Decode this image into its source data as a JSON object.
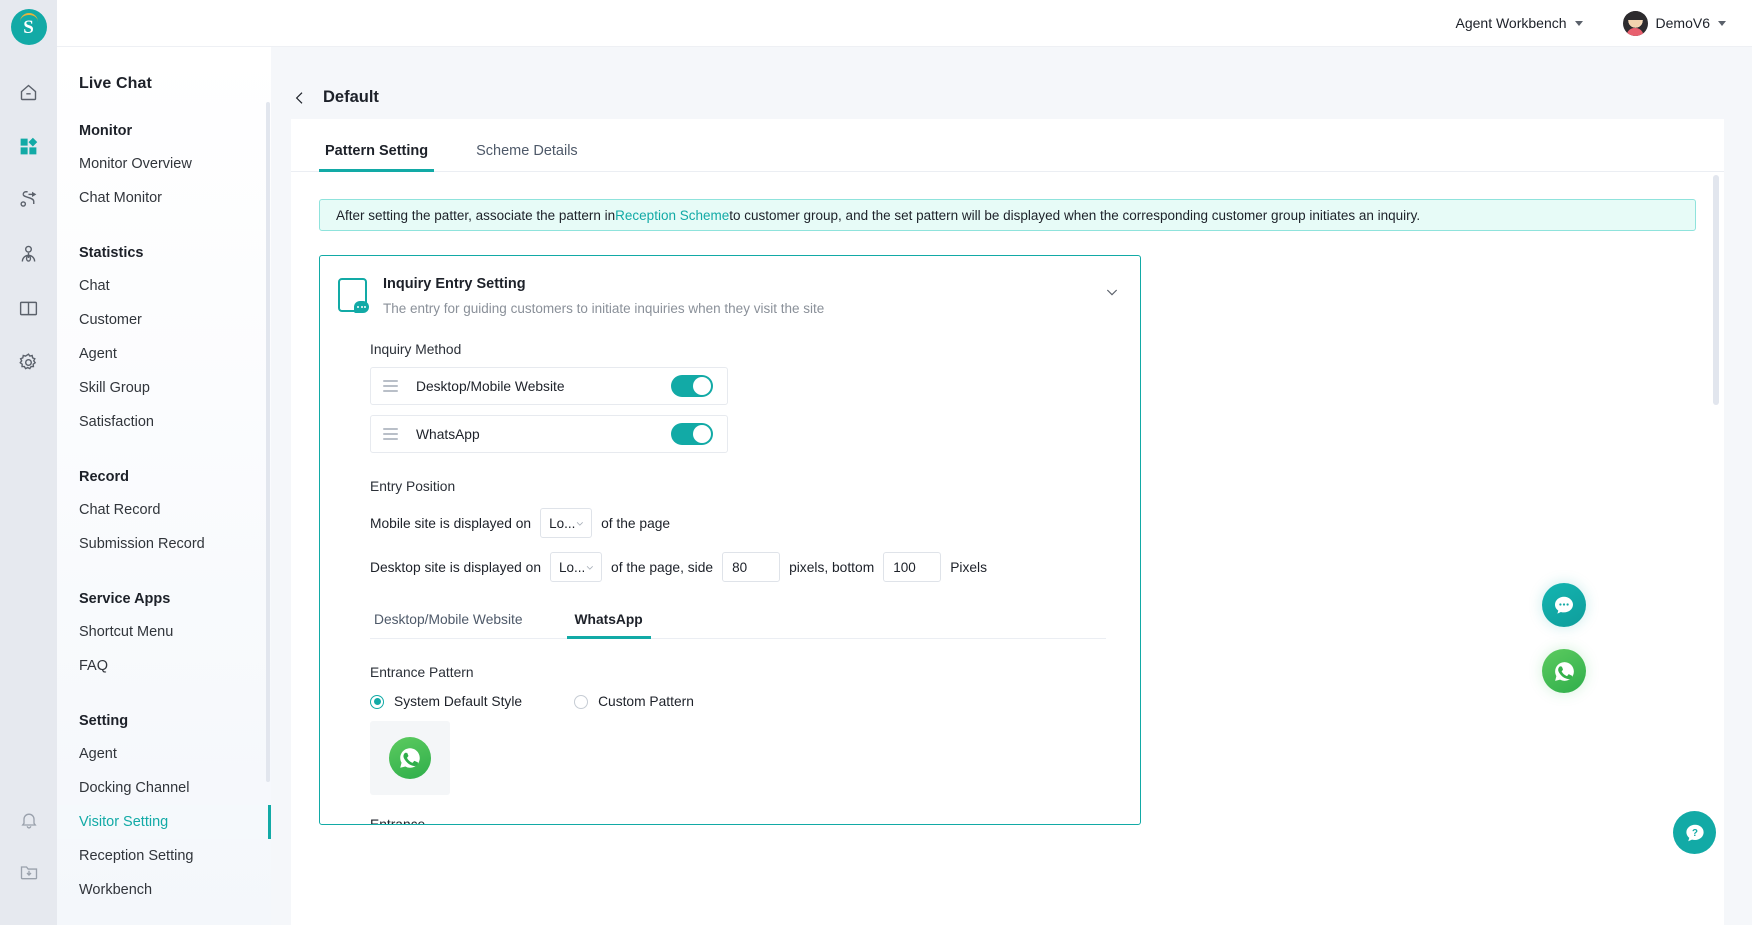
{
  "rail": {
    "logo_letter": "S",
    "icons": [
      {
        "name": "home-icon"
      },
      {
        "name": "apps-grid-icon"
      },
      {
        "name": "workflow-icon"
      },
      {
        "name": "visitor-insight-icon"
      },
      {
        "name": "knowledge-book-icon"
      },
      {
        "name": "gear-icon"
      }
    ],
    "bottom_icons": [
      {
        "name": "bell-icon"
      },
      {
        "name": "download-folder-icon"
      }
    ]
  },
  "topbar": {
    "workspace_label": "Agent Workbench",
    "user_label": "DemoV6"
  },
  "sidebar": {
    "title": "Live Chat",
    "groups": [
      {
        "label": "Monitor",
        "items": [
          {
            "label": "Monitor Overview",
            "active": false
          },
          {
            "label": "Chat Monitor",
            "active": false
          }
        ]
      },
      {
        "label": "Statistics",
        "items": [
          {
            "label": "Chat",
            "active": false
          },
          {
            "label": "Customer",
            "active": false
          },
          {
            "label": "Agent",
            "active": false
          },
          {
            "label": "Skill Group",
            "active": false
          },
          {
            "label": "Satisfaction",
            "active": false
          }
        ]
      },
      {
        "label": "Record",
        "items": [
          {
            "label": "Chat Record",
            "active": false
          },
          {
            "label": "Submission Record",
            "active": false
          }
        ]
      },
      {
        "label": "Service Apps",
        "items": [
          {
            "label": "Shortcut Menu",
            "active": false
          },
          {
            "label": "FAQ",
            "active": false
          }
        ]
      },
      {
        "label": "Setting",
        "items": [
          {
            "label": "Agent",
            "active": false
          },
          {
            "label": "Docking Channel",
            "active": false
          },
          {
            "label": "Visitor Setting",
            "active": true
          },
          {
            "label": "Reception Setting",
            "active": false
          },
          {
            "label": "Workbench",
            "active": false
          }
        ]
      }
    ]
  },
  "page": {
    "title": "Default",
    "back_icon": "chevron-left-icon"
  },
  "tabs": [
    {
      "label": "Pattern Setting",
      "active": true
    },
    {
      "label": "Scheme Details",
      "active": false
    }
  ],
  "banner": {
    "text_before": "After setting the patter, associate the pattern in ",
    "link": "Reception Scheme",
    "text_after": " to customer group, and the set pattern will be displayed when the corresponding customer group initiates an inquiry."
  },
  "card": {
    "title": "Inquiry Entry Setting",
    "subtitle": "The entry for guiding customers to initiate inquiries when they visit the site",
    "collapse_icon": "chevron-down-icon",
    "inquiry_method": {
      "label": "Inquiry Method",
      "rows": [
        {
          "name": "Desktop/Mobile Website",
          "enabled": true
        },
        {
          "name": "WhatsApp",
          "enabled": true
        }
      ]
    },
    "entry_position": {
      "label": "Entry Position",
      "mobile": {
        "prefix": "Mobile site is displayed on",
        "select_value": "Lo...",
        "suffix": "of the page"
      },
      "desktop": {
        "prefix": "Desktop site is displayed on",
        "select_value": "Lo...",
        "mid": "of the page, side",
        "side_value": "80",
        "mid2": "pixels, bottom",
        "bottom_value": "100",
        "suffix": "Pixels"
      }
    },
    "subtabs": [
      {
        "label": "Desktop/Mobile Website",
        "active": false
      },
      {
        "label": "WhatsApp",
        "active": true
      }
    ],
    "entrance_pattern": {
      "label": "Entrance Pattern",
      "options": [
        {
          "label": "System Default Style",
          "checked": true
        },
        {
          "label": "Custom Pattern",
          "checked": false
        }
      ],
      "preview_icon": "whatsapp-icon"
    }
  },
  "floating": [
    {
      "name": "chat-bubble-fab",
      "icon": "chat-dots-icon"
    },
    {
      "name": "whatsapp-fab",
      "icon": "whatsapp-icon"
    },
    {
      "name": "help-fab",
      "icon": "question-bubble-icon"
    }
  ],
  "colors": {
    "accent": "#12aaa6",
    "whatsapp_green": "#2fae4b",
    "banner_bg": "#e7fbf7",
    "rail_bg": "#e6e9ef"
  }
}
